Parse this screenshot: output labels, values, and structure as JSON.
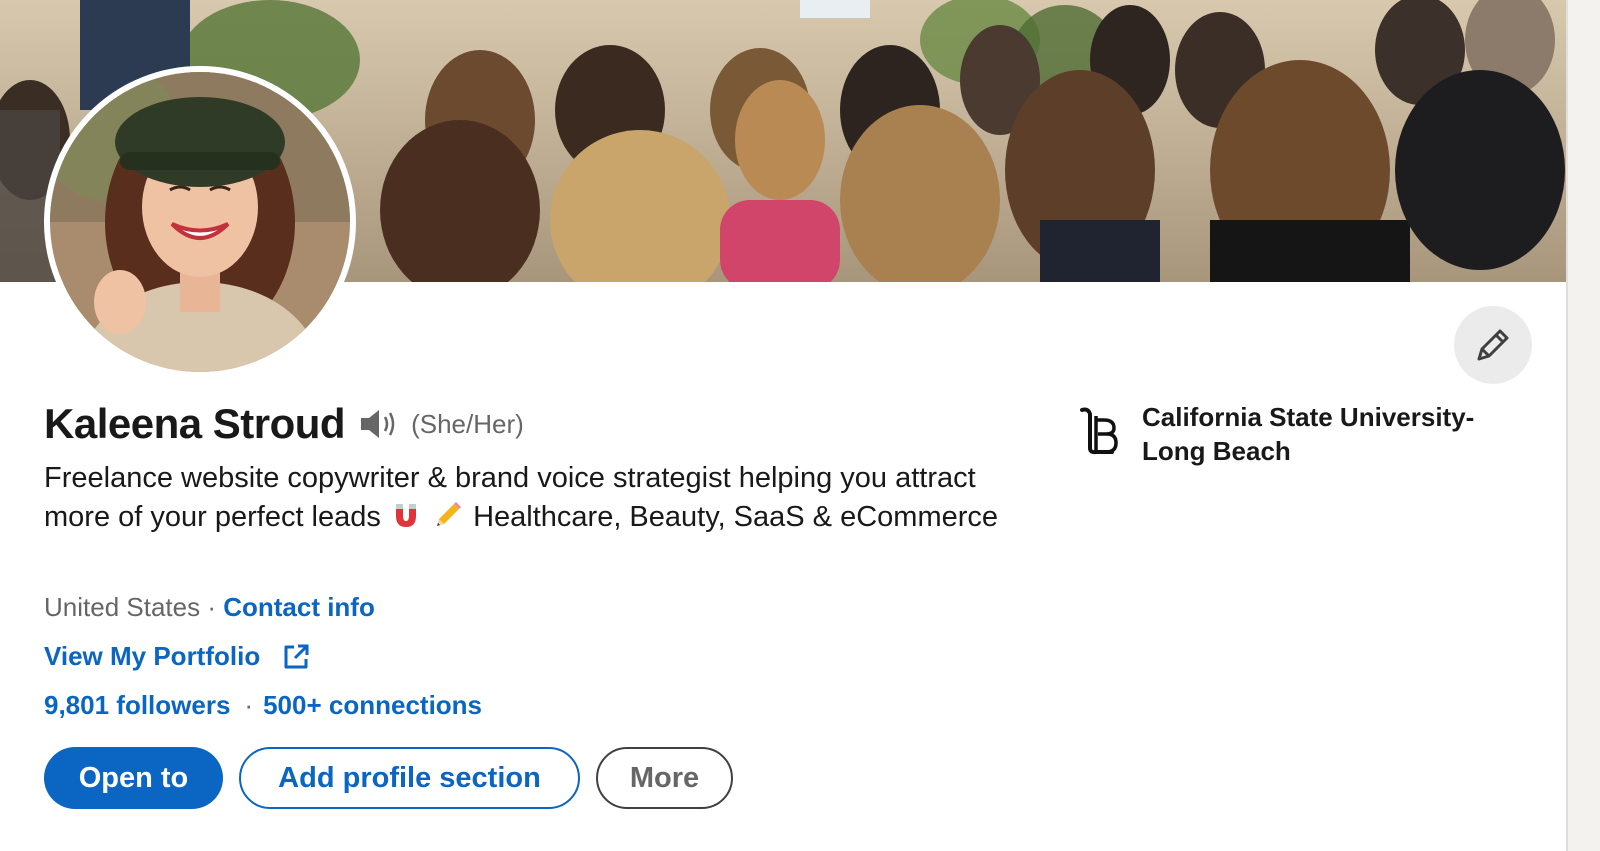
{
  "profile": {
    "name": "Kaleena Stroud",
    "pronouns": "(She/Her)",
    "headline_part1": "Freelance website copywriter & brand voice strategist helping you attract more of your perfect leads",
    "headline_part2": "Healthcare, Beauty, SaaS & eCommerce",
    "headline_emojis": [
      "magnet-icon",
      "pencil-icon"
    ],
    "location": "United States",
    "location_separator": " · ",
    "contact_info_label": "Contact info",
    "website_label": "View My Portfolio",
    "followers": "9,801 followers",
    "stats_separator": "·",
    "connections": "500+ connections"
  },
  "actions": {
    "open_to": "Open to",
    "add_section": "Add profile section",
    "more": "More"
  },
  "education": {
    "school": "California State University-Long Beach",
    "logo_icon": "lb-monogram-icon"
  },
  "icons": {
    "edit": "pencil-icon",
    "pronunciation": "speaker-icon",
    "external_link": "external-link-icon"
  },
  "colors": {
    "accent": "#0a66c2",
    "text_primary": "#191919",
    "text_secondary": "#666666",
    "edit_button_bg": "#ebebeb"
  }
}
